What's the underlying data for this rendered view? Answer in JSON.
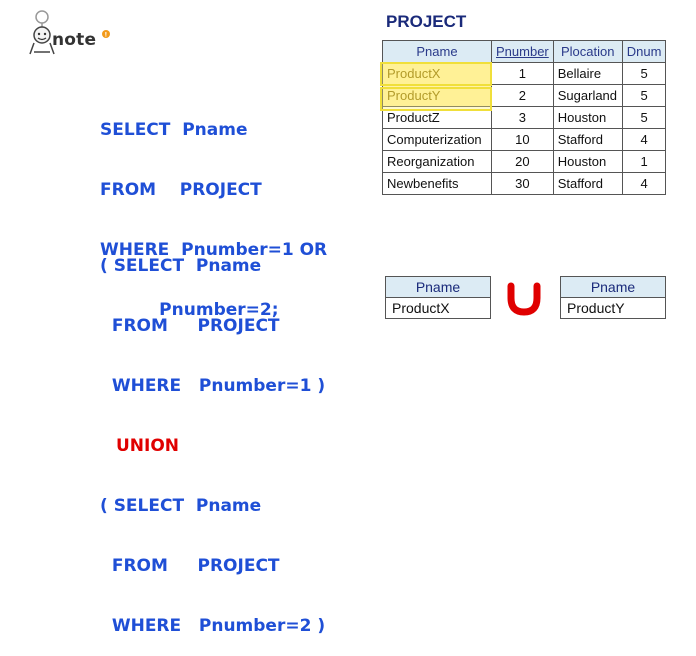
{
  "header": {
    "note_label": "note"
  },
  "sql_query_1": [
    "SELECT  Pname",
    "FROM    PROJECT",
    "WHERE  Pnumber=1 OR",
    "          Pnumber=2;"
  ],
  "sql_query_2": {
    "sub1": [
      "( SELECT  Pname",
      "  FROM     PROJECT",
      "  WHERE   Pnumber=1 )"
    ],
    "union": "UNION",
    "sub2": [
      "( SELECT  Pname",
      "  FROM     PROJECT",
      "  WHERE   Pnumber=2 )"
    ]
  },
  "project_table": {
    "title": "PROJECT",
    "headers": [
      "Pname",
      "Pnumber",
      "Plocation",
      "Dnum"
    ],
    "rows": [
      [
        "ProductX",
        "1",
        "Bellaire",
        "5"
      ],
      [
        "ProductY",
        "2",
        "Sugarland",
        "5"
      ],
      [
        "ProductZ",
        "3",
        "Houston",
        "5"
      ],
      [
        "Computerization",
        "10",
        "Stafford",
        "4"
      ],
      [
        "Reorganization",
        "20",
        "Houston",
        "1"
      ],
      [
        "Newbenefits",
        "30",
        "Stafford",
        "4"
      ]
    ]
  },
  "result_left": {
    "header": "Pname",
    "value": "ProductX"
  },
  "result_right": {
    "header": "Pname",
    "value": "ProductY"
  },
  "colors": {
    "sql_blue": "#1f4fd6",
    "union_red": "#e00000",
    "header_bg": "#dcebf4",
    "highlight_yellow": "#fff2a6"
  }
}
